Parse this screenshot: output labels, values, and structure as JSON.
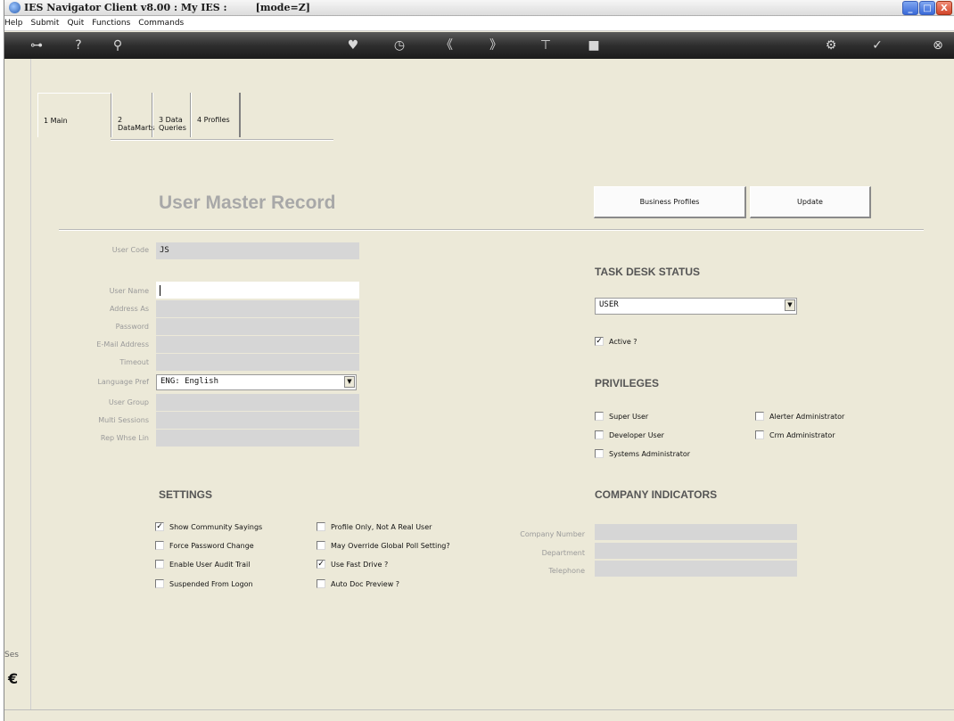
{
  "window": {
    "title": "IES Navigator Client v8.00 : My IES :",
    "mode": "[mode=Z]",
    "buttons": {
      "minimize": "_",
      "maximize": "□",
      "close": "X"
    }
  },
  "menu": [
    "Help",
    "Submit",
    "Quit",
    "Functions",
    "Commands"
  ],
  "toolbar": {
    "icons": [
      "key-icon",
      "help-icon",
      "search-icon",
      "heart-icon",
      "clock-icon",
      "rewind-icon",
      "forward-icon",
      "tree-icon",
      "stop-icon",
      "settings-icon",
      "ok-icon",
      "close-icon"
    ],
    "glyphs": [
      "⊶",
      "?",
      "⚲",
      "♥",
      "◷",
      "《",
      "》",
      "⊤",
      "■",
      "⚙",
      "✓",
      "⊗"
    ]
  },
  "tabs": [
    {
      "label": "1 Main"
    },
    {
      "label": "2 DataMarts"
    },
    {
      "label": "3 Data Queries"
    },
    {
      "label": "4 Profiles"
    }
  ],
  "page_title": "User Master Record",
  "buttons": {
    "business_profiles": "Business Profiles",
    "update": "Update"
  },
  "fields": [
    {
      "label": "User Code",
      "value": "JS",
      "white": false
    },
    {
      "label": "User Name",
      "value": "",
      "white": true
    },
    {
      "label": "Address As",
      "value": "",
      "white": false
    },
    {
      "label": "Password",
      "value": "",
      "white": false
    },
    {
      "label": "E-Mail Address",
      "value": "",
      "white": false
    },
    {
      "label": "Timeout",
      "value": "",
      "white": false
    },
    {
      "label": "Language Pref",
      "value": "ENG: English",
      "white": true
    },
    {
      "label": "User Group",
      "value": "",
      "white": false
    },
    {
      "label": "Multi Sessions",
      "value": "",
      "white": false
    },
    {
      "label": "Rep Whse Lin",
      "value": "",
      "white": false
    }
  ],
  "task_desk": {
    "heading": "TASK DESK STATUS",
    "status": "USER",
    "active_label": "Active ?",
    "active": true
  },
  "privileges": {
    "heading": "PRIVILEGES",
    "items": [
      {
        "label": "Super User",
        "checked": false
      },
      {
        "label": "Developer User",
        "checked": false
      },
      {
        "label": "Systems Administrator",
        "checked": false
      },
      {
        "label": "Alerter Administrator",
        "checked": false
      },
      {
        "label": "Crm Administrator",
        "checked": false
      }
    ]
  },
  "settings": {
    "heading": "SETTINGS",
    "items": [
      {
        "label": "Show Community Sayings",
        "checked": true
      },
      {
        "label": "Force Password Change",
        "checked": false
      },
      {
        "label": "Enable User Audit Trail",
        "checked": false
      },
      {
        "label": "Suspended From Logon",
        "checked": false
      },
      {
        "label": "Profile Only, Not A Real User",
        "checked": false
      },
      {
        "label": "May Override Global Poll Setting?",
        "checked": false
      },
      {
        "label": "Use Fast Drive ?",
        "checked": true
      },
      {
        "label": "Auto Doc Preview ?",
        "checked": false
      }
    ]
  },
  "company": {
    "heading": "COMPANY INDICATORS",
    "fields": [
      {
        "label": "Company Number",
        "value": ""
      },
      {
        "label": "Department",
        "value": ""
      },
      {
        "label": "Telephone",
        "value": ""
      }
    ]
  },
  "status_bar": {
    "session_label": "Ses",
    "session_glyph": "€"
  }
}
